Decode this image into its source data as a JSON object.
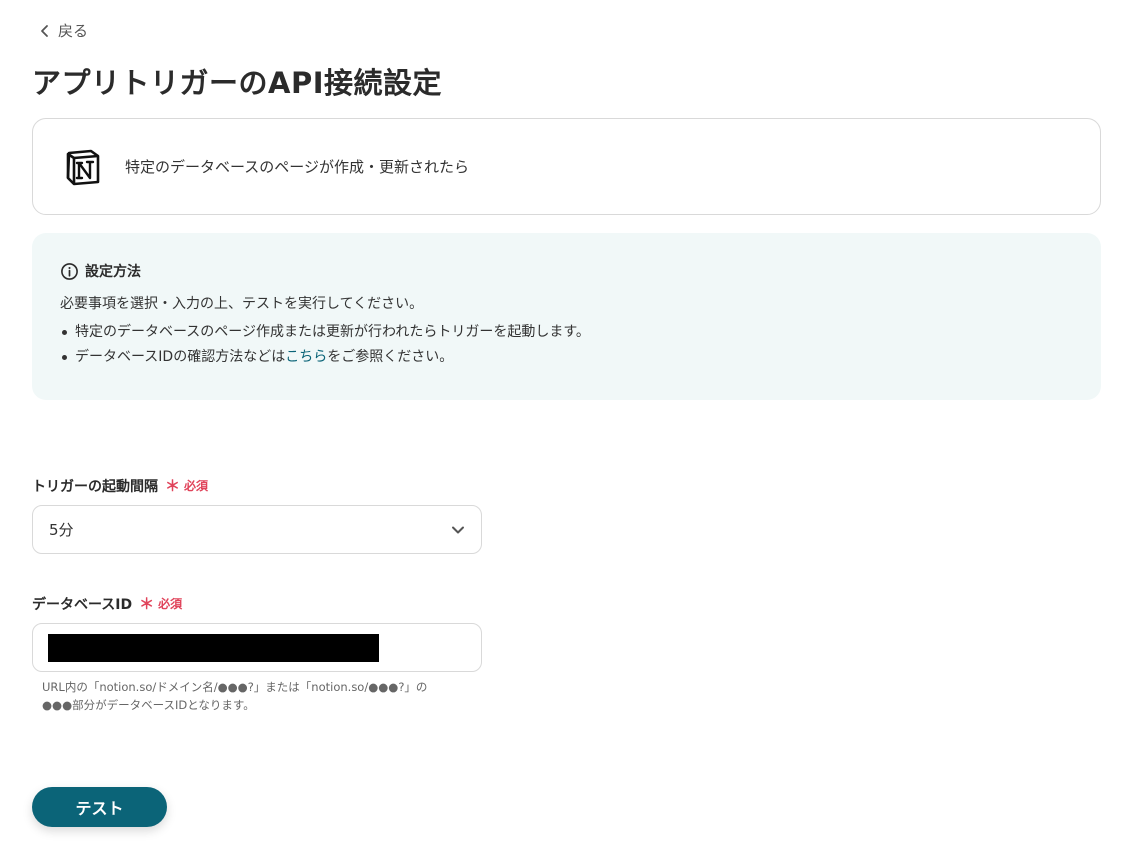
{
  "nav": {
    "back_label": "戻る"
  },
  "page": {
    "title": "アプリトリガーのAPI接続設定"
  },
  "trigger": {
    "app_icon": "notion-logo-icon",
    "label": "特定のデータベースのページが作成・更新されたら"
  },
  "info": {
    "heading": "設定方法",
    "description": "必要事項を選択・入力の上、テストを実行してください。",
    "bullets": [
      {
        "text": "特定のデータベースのページ作成または更新が行われたらトリガーを起動します。"
      },
      {
        "prefix": "データベースIDの確認方法などは",
        "link": "こちら",
        "suffix": "をご参照ください。"
      }
    ]
  },
  "fields": {
    "interval": {
      "label": "トリガーの起動間隔",
      "required_mark": "＊",
      "required_text": "必須",
      "value": "5分"
    },
    "database_id": {
      "label": "データベースID",
      "required_mark": "＊",
      "required_text": "必須",
      "help_line1": "URL内の「notion.so/ドメイン名/●●●?」または「notion.so/●●●?」の",
      "help_line2": "●●●部分がデータベースIDとなります。"
    }
  },
  "actions": {
    "test_label": "テスト"
  },
  "colors": {
    "accent": "#0b6478",
    "required": "#e0435a",
    "info_bg": "#f1f8f8"
  }
}
